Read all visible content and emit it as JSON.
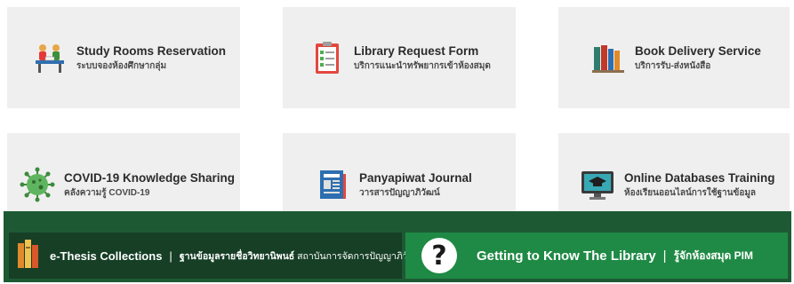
{
  "cards": [
    {
      "title": "Study Rooms Reservation",
      "subtitle": "ระบบจองห้องศึกษากลุ่ม",
      "icon": "study-group-icon"
    },
    {
      "title": "Library Request Form",
      "subtitle": "บริการแนะนำทรัพยากรเข้าห้องสมุด",
      "icon": "clipboard-checklist-icon"
    },
    {
      "title": "Book Delivery Service",
      "subtitle": "บริการรับ-ส่งหนังสือ",
      "icon": "books-shelf-icon"
    },
    {
      "title": "COVID-19 Knowledge Sharing",
      "subtitle": "คลังความรู้ COVID-19",
      "icon": "virus-icon"
    },
    {
      "title": "Panyapiwat Journal",
      "subtitle": "วารสารปัญญาภิวัฒน์",
      "icon": "journal-icon"
    },
    {
      "title": "Online Databases Training",
      "subtitle": "ห้องเรียนออนไลน์การใช้ฐานข้อมูล",
      "icon": "monitor-graduation-icon"
    }
  ],
  "banners": {
    "thesis": {
      "title": "e-Thesis Collections",
      "separator": "|",
      "subtitle_bold": "ฐานข้อมูลรายชื่อวิทยานิพนธ์",
      "subtitle_rest": " สถาบันการจัดการปัญญาภิวัฒน์",
      "icon": "books-stack-icon"
    },
    "know_library": {
      "title": "Getting to Know The Library",
      "separator": "|",
      "subtitle": "รู้จักห้องสมุด PIM",
      "icon_glyph": "?",
      "icon": "question-icon"
    }
  },
  "colors": {
    "card_bg": "#efefef",
    "band_green": "#1d5a34",
    "thesis_bg": "#163f26",
    "know_bg": "#1f8a45"
  }
}
